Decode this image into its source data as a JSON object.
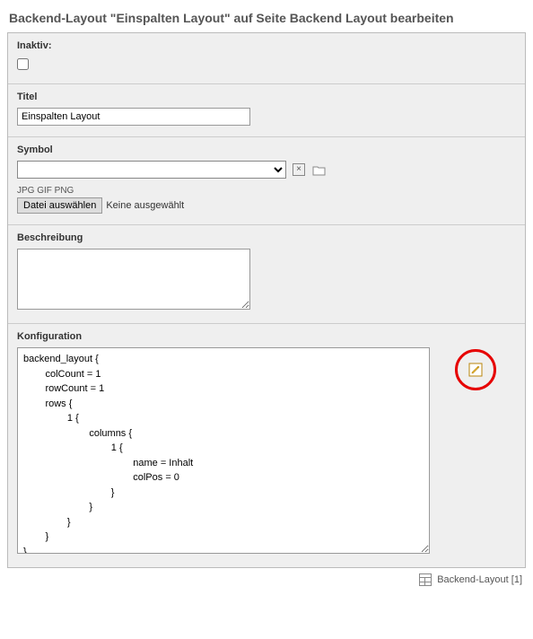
{
  "page_title": "Backend-Layout \"Einspalten Layout\" auf Seite Backend Layout bearbeiten",
  "sections": {
    "inactive": {
      "label": "Inaktiv:",
      "checked": false
    },
    "title": {
      "label": "Titel",
      "value": "Einspalten Layout"
    },
    "symbol": {
      "label": "Symbol",
      "selected": "",
      "allowed_ext": "JPG GIF PNG",
      "choose_button": "Datei auswählen",
      "no_file": "Keine ausgewählt"
    },
    "description": {
      "label": "Beschreibung",
      "value": ""
    },
    "config": {
      "label": "Konfiguration",
      "value": "backend_layout {\n        colCount = 1\n        rowCount = 1\n        rows {\n                1 {\n                        columns {\n                                1 {\n                                        name = Inhalt\n                                        colPos = 0\n                                }\n                        }\n                }\n        }\n}"
    }
  },
  "footer": {
    "label": "Backend-Layout",
    "count": "[1]"
  }
}
